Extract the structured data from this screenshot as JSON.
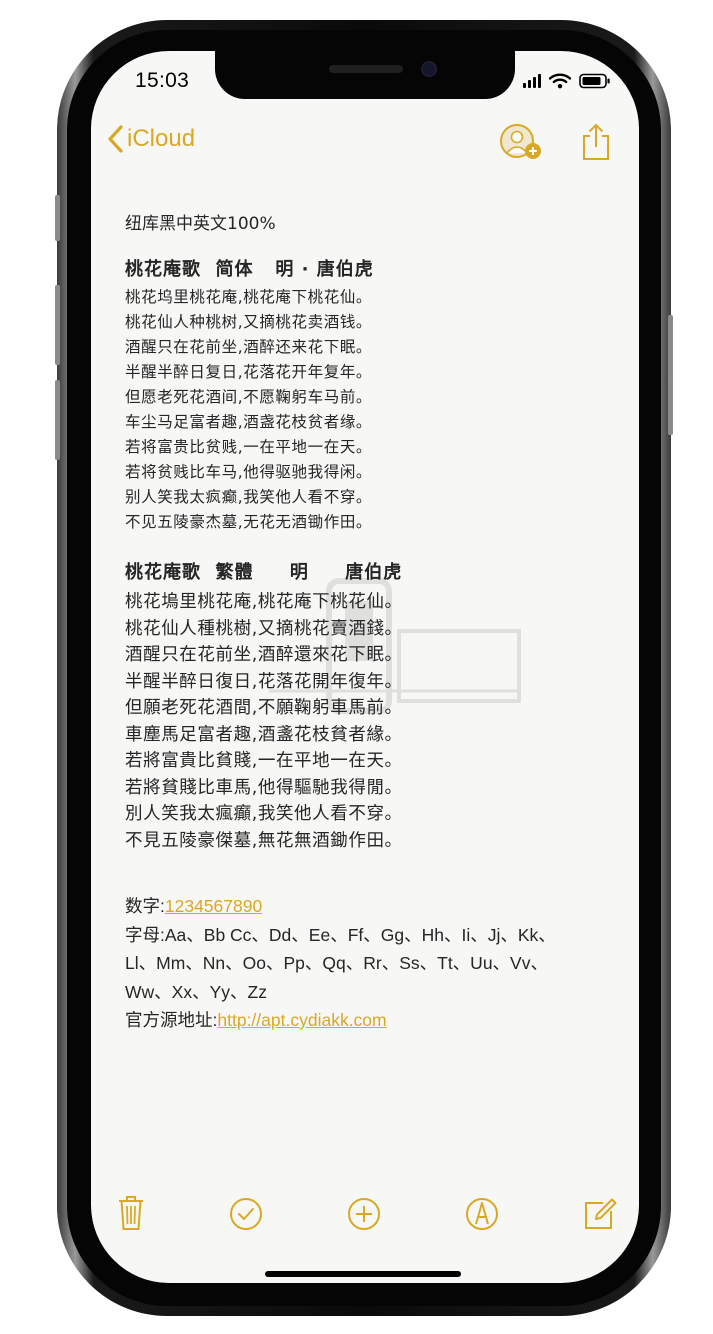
{
  "status_bar": {
    "time": "15:03"
  },
  "nav": {
    "back_label": "iCloud",
    "icons": [
      "chevron-left-icon",
      "add-person-icon",
      "share-icon"
    ]
  },
  "note": {
    "intro": "纽库黑中英文100%",
    "simplified": {
      "heading": "桃花庵歌  简体   明 · 唐伯虎",
      "lines": [
        "桃花坞里桃花庵,桃花庵下桃花仙。",
        "桃花仙人种桃树,又摘桃花卖酒钱。",
        "酒醒只在花前坐,酒醉还来花下眠。",
        "半醒半醉日复日,花落花开年复年。",
        "但愿老死花酒间,不愿鞠躬车马前。",
        "车尘马足富者趣,酒盏花枝贫者缘。",
        "若将富贵比贫贱,一在平地一在天。",
        "若将贫贱比车马,他得驱驰我得闲。",
        "别人笑我太疯癫,我笑他人看不穿。",
        "不见五陵豪杰墓,无花无酒锄作田。"
      ]
    },
    "traditional": {
      "heading": "桃花庵歌  繁體     明     唐伯虎",
      "lines": [
        "桃花塢里桃花庵,桃花庵下桃花仙。",
        "桃花仙人種桃樹,又摘桃花賣酒錢。",
        "酒醒只在花前坐,酒醉還來花下眠。",
        "半醒半醉日復日,花落花開年復年。",
        "但願老死花酒間,不願鞠躬車馬前。",
        "車塵馬足富者趣,酒盞花枝貧者緣。",
        "若將富貴比貧賤,一在平地一在天。",
        "若將貧賤比車馬,他得驅馳我得閒。",
        "別人笑我太瘋癲,我笑他人看不穿。",
        "不見五陵豪傑墓,無花無酒鋤作田。"
      ]
    },
    "digits_label": "数字:",
    "digits_value": "1234567890",
    "letters_line1": "字母:Aa、Bb Cc、Dd、Ee、Ff、Gg、Hh、Ii、Jj、Kk、",
    "letters_line2": "Ll、Mm、Nn、Oo、Pp、Qq、Rr、Ss、Tt、Uu、Vv、",
    "letters_line3": "Ww、Xx、Yy、Zz",
    "source_label": "官方源地址:",
    "source_url": "http://apt.cydiakk.com"
  },
  "toolbar": {
    "icons": [
      "trash-icon",
      "checklist-icon",
      "add-icon",
      "markup-icon",
      "compose-icon"
    ]
  },
  "colors": {
    "accent": "#d9a826",
    "text": "#262626",
    "paper": "#f7f7f5"
  }
}
